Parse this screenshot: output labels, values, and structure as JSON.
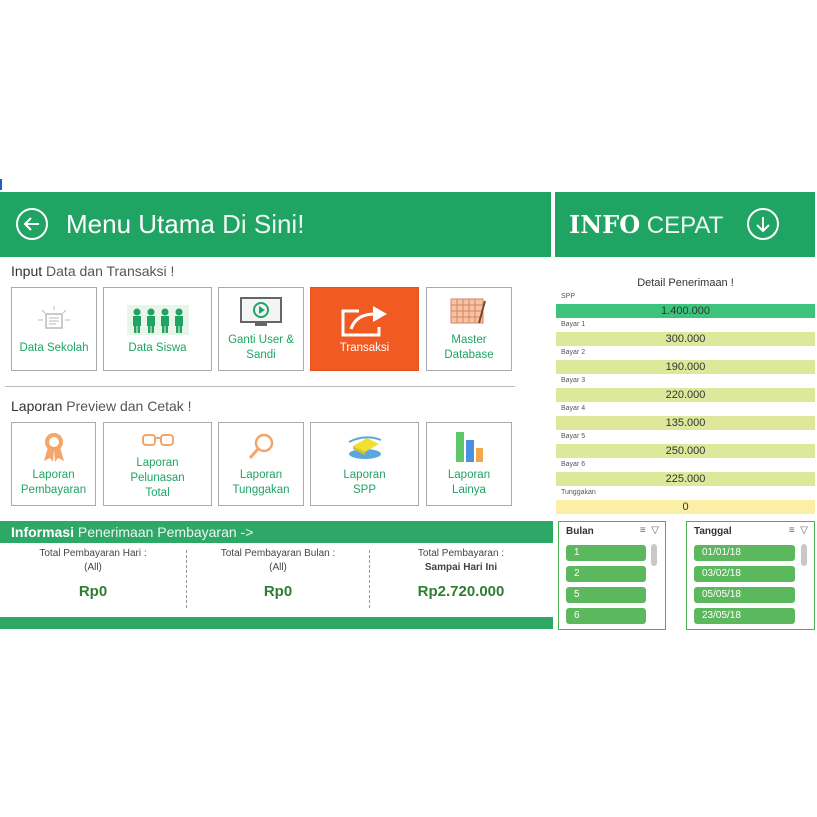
{
  "header": {
    "title_bold": "Menu Utama",
    "title_light": "Di Sini!",
    "right_title_bold": "INFO",
    "right_title_light": "CEPAT"
  },
  "input_section": {
    "title_bold": "Input",
    "title_light": "Data dan Transaksi !",
    "tiles": [
      {
        "label": "Data Sekolah",
        "icon": "school-data-icon"
      },
      {
        "label": "Data Siswa",
        "icon": "students-icon"
      },
      {
        "label": "Ganti User &\nSandi",
        "icon": "monitor-play-icon"
      },
      {
        "label": "Transaksi",
        "icon": "share-arrow-icon",
        "active": true
      },
      {
        "label": "Master\nDatabase",
        "icon": "database-grid-icon"
      }
    ]
  },
  "report_section": {
    "title_bold": "Laporan",
    "title_light": "Preview dan Cetak !",
    "tiles": [
      {
        "label": "Laporan\nPembayaran",
        "icon": "ribbon-award-icon"
      },
      {
        "label": "Laporan\nPelunasan\nTotal",
        "icon": "glasses-icon"
      },
      {
        "label": "Laporan\nTunggakan",
        "icon": "magnifier-icon"
      },
      {
        "label": "Laporan\nSPP",
        "icon": "book-stack-icon"
      },
      {
        "label": "Laporan\nLainya",
        "icon": "bar-chart-icon"
      }
    ]
  },
  "info_section": {
    "title_bold": "Informasi",
    "title_light": "Penerimaan Pembayaran ->",
    "columns": [
      {
        "label": "Total Pembayaran Hari :",
        "sub": "(All)",
        "value": "Rp0"
      },
      {
        "label": "Total Pembayaran Bulan :",
        "sub": "(All)",
        "value": "Rp0"
      },
      {
        "label": "Total Pembayaran :",
        "sub": "Sampai Hari Ini",
        "value": "Rp2.720.000"
      }
    ]
  },
  "detail": {
    "title": "Detail Penerimaan !",
    "rows": [
      {
        "label": "SPP",
        "value": "1.400.000",
        "color": "#3cc47c"
      },
      {
        "label": "Bayar 1",
        "value": "300.000",
        "color": "#dde89a"
      },
      {
        "label": "Bayar 2",
        "value": "190.000",
        "color": "#dde89a"
      },
      {
        "label": "Bayar 3",
        "value": "220.000",
        "color": "#dde89a"
      },
      {
        "label": "Bayar 4",
        "value": "135.000",
        "color": "#dde89a"
      },
      {
        "label": "Bayar 5",
        "value": "250.000",
        "color": "#dde89a"
      },
      {
        "label": "Bayar 6",
        "value": "225.000",
        "color": "#dde89a"
      },
      {
        "label": "Tunggakan",
        "value": "0",
        "color": "#fbeea6"
      }
    ]
  },
  "slicers": {
    "bulan": {
      "title": "Bulan",
      "items": [
        "1",
        "2",
        "5",
        "6"
      ]
    },
    "tanggal": {
      "title": "Tanggal",
      "items": [
        "01/01/18",
        "03/02/18",
        "05/05/18",
        "23/05/18"
      ]
    }
  },
  "colors": {
    "brand_green": "#1fa463",
    "accent_orange": "#f15a22",
    "slicer_item": "#5cb85c"
  }
}
